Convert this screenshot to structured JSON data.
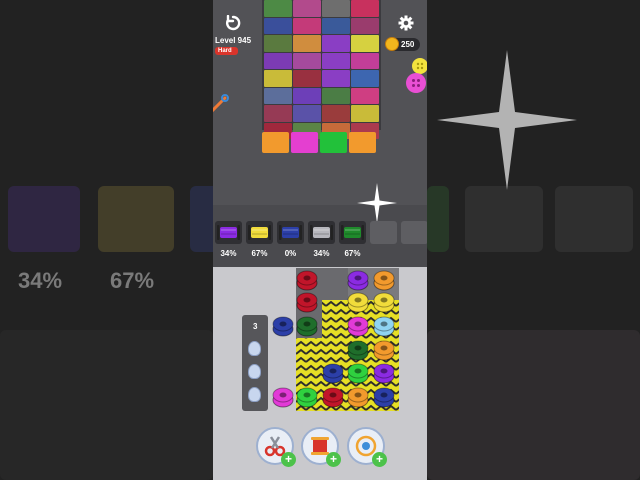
{
  "level": {
    "title": "Level 945",
    "difficulty": "Hard"
  },
  "coins": {
    "value": "250"
  },
  "icons": {
    "restart": "restart-icon",
    "settings": "gear-icon",
    "coin": "coin-icon",
    "hook": "sewing-hook-icon",
    "button": "button-icon"
  },
  "fabric_rows": [
    [
      "#4d8a45",
      "#b24a8c",
      "#6e6e6e",
      "#c8315e"
    ],
    [
      "#3a4f9b",
      "#c43a79",
      "#3a5a9a",
      "#9a3c6d"
    ],
    [
      "#5a7a3f",
      "#d08d3e",
      "#8a3ec4",
      "#d6d140"
    ],
    [
      "#7c3bb4",
      "#a54a9d",
      "#8a3ec4",
      "#c23e98"
    ],
    [
      "#c9bb39",
      "#993040",
      "#8a3ec4",
      "#3d66b0"
    ],
    [
      "#5c6e9b",
      "#6d3fb8",
      "#4b7d45",
      "#cf3e82"
    ],
    [
      "#963a55",
      "#5a52a8",
      "#9a3c3c",
      "#c9bb39"
    ],
    [
      "#a0283c",
      "#5b8446",
      "#c66b3a",
      "#ab3a4e"
    ]
  ],
  "fabric_bottom": [
    "#f29a2d",
    "#e43fd0",
    "#22c13a",
    "#f29a2d"
  ],
  "collector_slots": [
    {
      "color": "#8b2be2",
      "pct": "34%"
    },
    {
      "color": "#f1dc3b",
      "pct": "67%"
    },
    {
      "color": "#2c3fa8",
      "pct": "0%"
    },
    {
      "color": "#b7b7bd",
      "pct": "34%"
    },
    {
      "color": "#1f8a2b",
      "pct": "67%"
    },
    {
      "color": "",
      "pct": ""
    },
    {
      "color": "",
      "pct": ""
    }
  ],
  "conveyor": {
    "count": "3"
  },
  "spools": [
    {
      "c": "#c1152a",
      "col": 0,
      "row": 0
    },
    {
      "c": "#8b2be2",
      "col": 2,
      "row": 0
    },
    {
      "c": "#f29a2d",
      "col": 3,
      "row": 0
    },
    {
      "c": "#c1152a",
      "col": 0,
      "row": 1
    },
    {
      "c": "#f1dc3b",
      "col": 2,
      "row": 1
    },
    {
      "c": "#f1dc3b",
      "col": 3,
      "row": 1
    },
    {
      "c": "#2c3fa8",
      "col": -1,
      "row": 2
    },
    {
      "c": "#1f6e2b",
      "col": 0,
      "row": 2
    },
    {
      "c": "#e23ad7",
      "col": 2,
      "row": 2
    },
    {
      "c": "#8fd3f2",
      "col": 3,
      "row": 2
    },
    {
      "c": "#1f6e2b",
      "col": 2,
      "row": 3
    },
    {
      "c": "#f29a2d",
      "col": 3,
      "row": 3
    },
    {
      "c": "#2c3fa8",
      "col": 1,
      "row": 4
    },
    {
      "c": "#2fd13f",
      "col": 2,
      "row": 4
    },
    {
      "c": "#8b2be2",
      "col": 3,
      "row": 4
    },
    {
      "c": "#e23ad7",
      "col": -1,
      "row": 5
    },
    {
      "c": "#2fd13f",
      "col": 0,
      "row": 5
    },
    {
      "c": "#c1152a",
      "col": 1,
      "row": 5
    },
    {
      "c": "#f29a2d",
      "col": 2,
      "row": 5
    },
    {
      "c": "#2c3fa8",
      "col": 3,
      "row": 5
    }
  ],
  "powerups": [
    {
      "name": "scissors-powerup",
      "icon": "scissors-icon"
    },
    {
      "name": "thread-powerup",
      "icon": "thread-spool-icon"
    },
    {
      "name": "magnet-powerup",
      "icon": "magnet-icon"
    }
  ],
  "backdrop_left_pcts": [
    "34%",
    "67%"
  ]
}
